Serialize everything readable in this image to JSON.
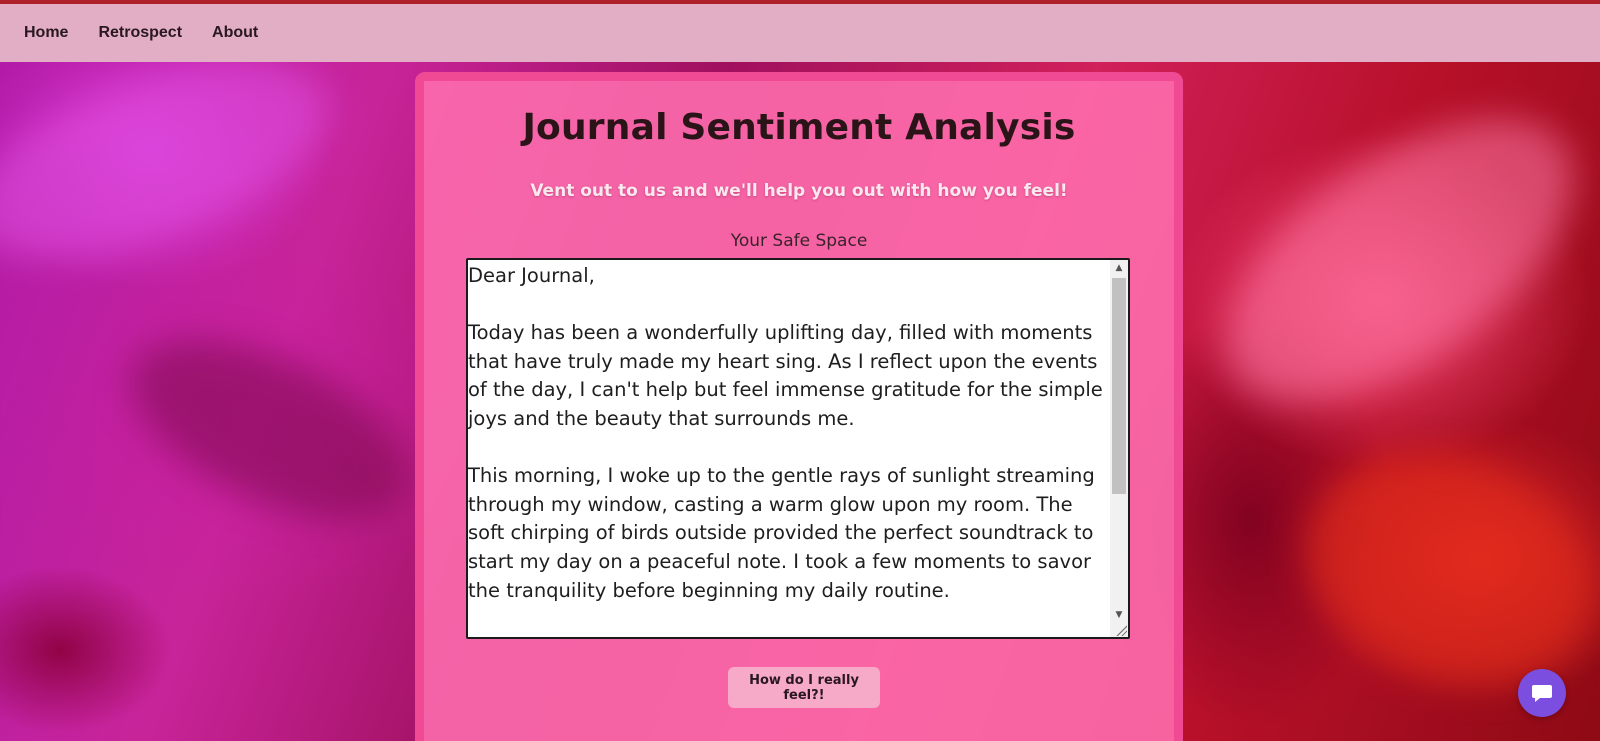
{
  "nav": {
    "items": [
      {
        "label": "Home"
      },
      {
        "label": "Retrospect"
      },
      {
        "label": "About"
      }
    ]
  },
  "card": {
    "title": "Journal Sentiment Analysis",
    "subtitle": "Vent out to us and we'll help you out with how you feel!",
    "label": "Your Safe Space",
    "journal_value": "Dear Journal,\n\nToday has been a wonderfully uplifting day, filled with moments that have truly made my heart sing. As I reflect upon the events of the day, I can't help but feel immense gratitude for the simple joys and the beauty that surrounds me.\n\nThis morning, I woke up to the gentle rays of sunlight streaming through my window, casting a warm glow upon my room. The soft chirping of birds outside provided the perfect soundtrack to start my day on a peaceful note. I took a few moments to savor the tranquility before beginning my daily routine.",
    "button_label": "How do I really feel?!"
  },
  "colors": {
    "navbar_bg": "#e2aec6",
    "navbar_top_border": "#b0202a",
    "card_bg": "#ff6eaf",
    "card_border": "#f04a94",
    "button_bg": "#f7a9c8",
    "chat_bubble": "#7b4ee0"
  },
  "icons": {
    "chat": "chat-bubble-icon"
  }
}
